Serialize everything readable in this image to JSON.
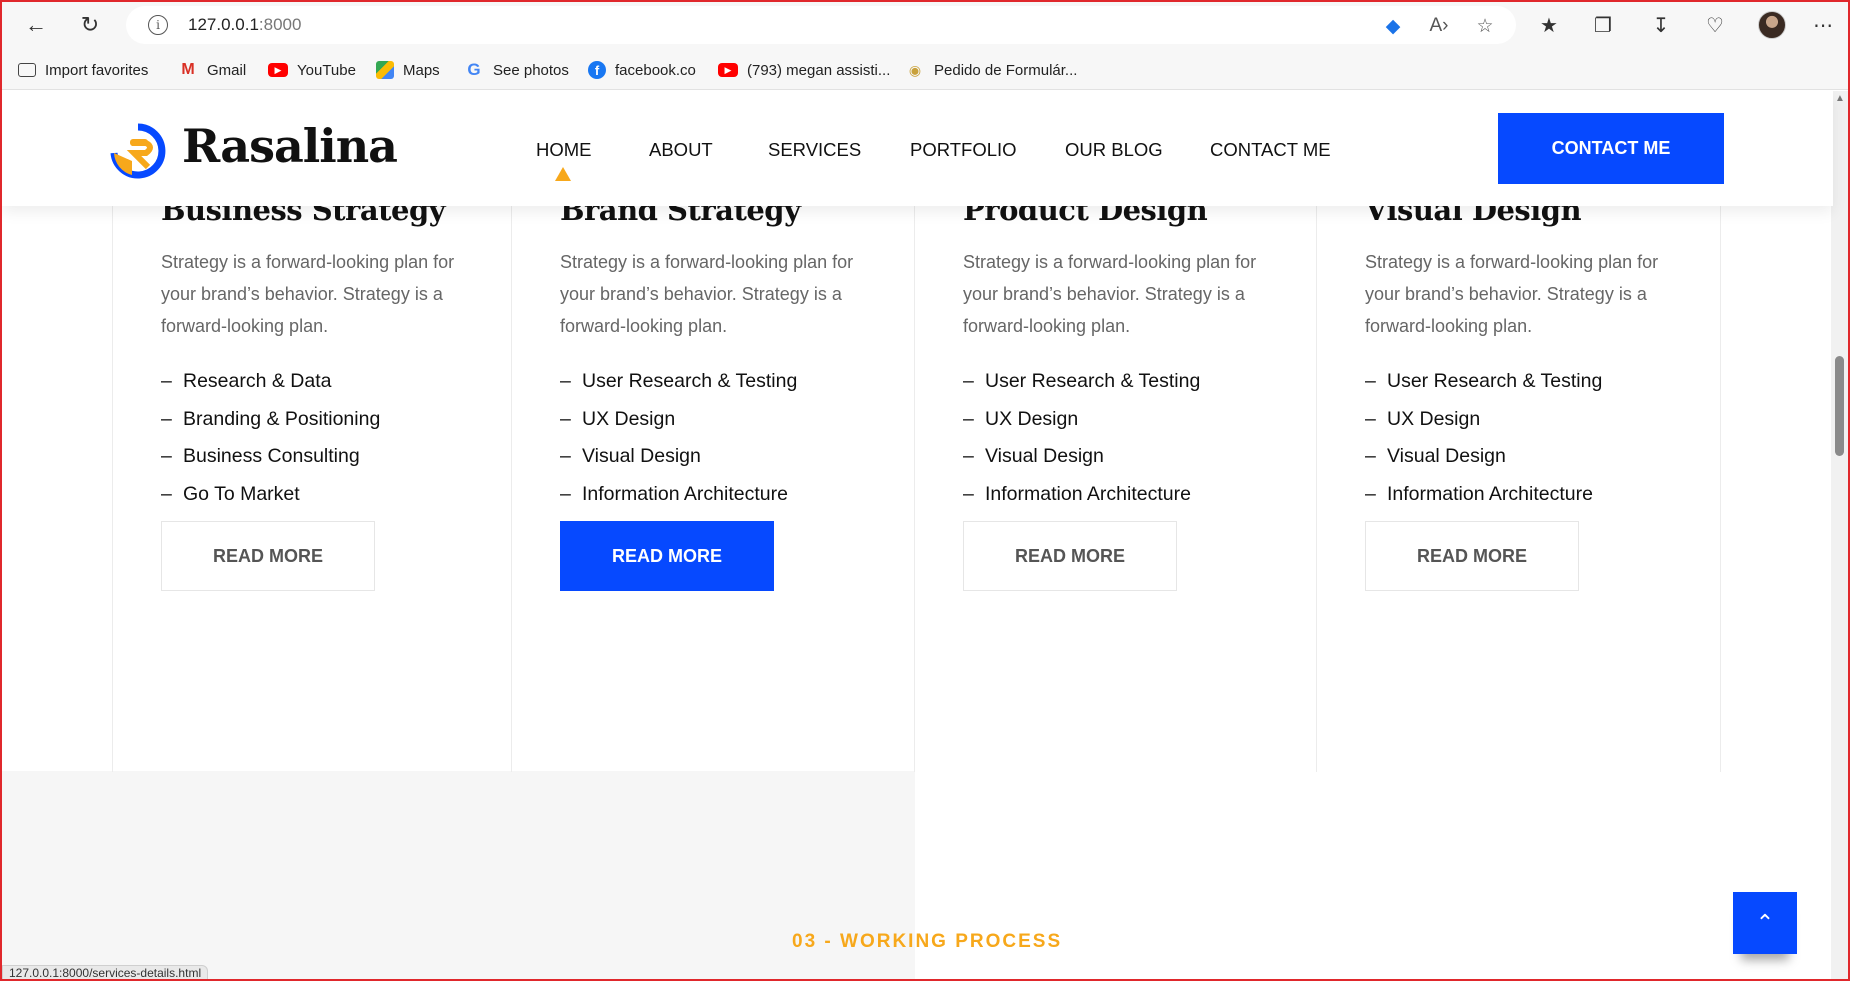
{
  "browser": {
    "url_host": "127.0.0.1",
    "url_port": ":8000",
    "bookmarks": [
      {
        "label": "Import favorites",
        "icon": "folder-icon"
      },
      {
        "label": "Gmail",
        "icon": "gmail-icon"
      },
      {
        "label": "YouTube",
        "icon": "youtube-icon"
      },
      {
        "label": "Maps",
        "icon": "maps-icon"
      },
      {
        "label": "See photos",
        "icon": "google-icon"
      },
      {
        "label": "facebook.co",
        "icon": "facebook-icon"
      },
      {
        "label": "(793) megan assisti...",
        "icon": "youtube-icon"
      },
      {
        "label": "Pedido de Formulár...",
        "icon": "eye-icon"
      }
    ],
    "status_url": "127.0.0.1:8000/services-details.html"
  },
  "site": {
    "logo_text": "Rasalina",
    "nav": [
      "HOME",
      "ABOUT",
      "SERVICES",
      "PORTFOLIO",
      "OUR BLOG",
      "CONTACT ME"
    ],
    "active_nav": "HOME",
    "cta_label": "CONTACT ME"
  },
  "services": [
    {
      "title": "Business Strategy",
      "description": "Strategy is a forward-looking plan for your brand’s behavior. Strategy is a forward-looking plan.",
      "items": [
        "Research & Data",
        "Branding & Positioning",
        "Business Consulting",
        "Go To Market"
      ],
      "button": "READ MORE",
      "highlighted": false
    },
    {
      "title": "Brand Strategy",
      "description": "Strategy is a forward-looking plan for your brand’s behavior. Strategy is a forward-looking plan.",
      "items": [
        "User Research & Testing",
        "UX Design",
        "Visual Design",
        "Information Architecture"
      ],
      "button": "READ MORE",
      "highlighted": true
    },
    {
      "title": "Product Design",
      "description": "Strategy is a forward-looking plan for your brand’s behavior. Strategy is a forward-looking plan.",
      "items": [
        "User Research & Testing",
        "UX Design",
        "Visual Design",
        "Information Architecture"
      ],
      "button": "READ MORE",
      "highlighted": false
    },
    {
      "title": "Visual Design",
      "description": "Strategy is a forward-looking plan for your brand’s behavior. Strategy is a forward-looking plan.",
      "items": [
        "User Research & Testing",
        "UX Design",
        "Visual Design",
        "Information Architecture"
      ],
      "button": "READ MORE",
      "highlighted": false
    }
  ],
  "list_dash": "–",
  "section_label": "03 - WORKING PROCESS",
  "colors": {
    "accent": "#0649ff",
    "highlight": "#f7a81b",
    "frame": "#e0282c"
  }
}
